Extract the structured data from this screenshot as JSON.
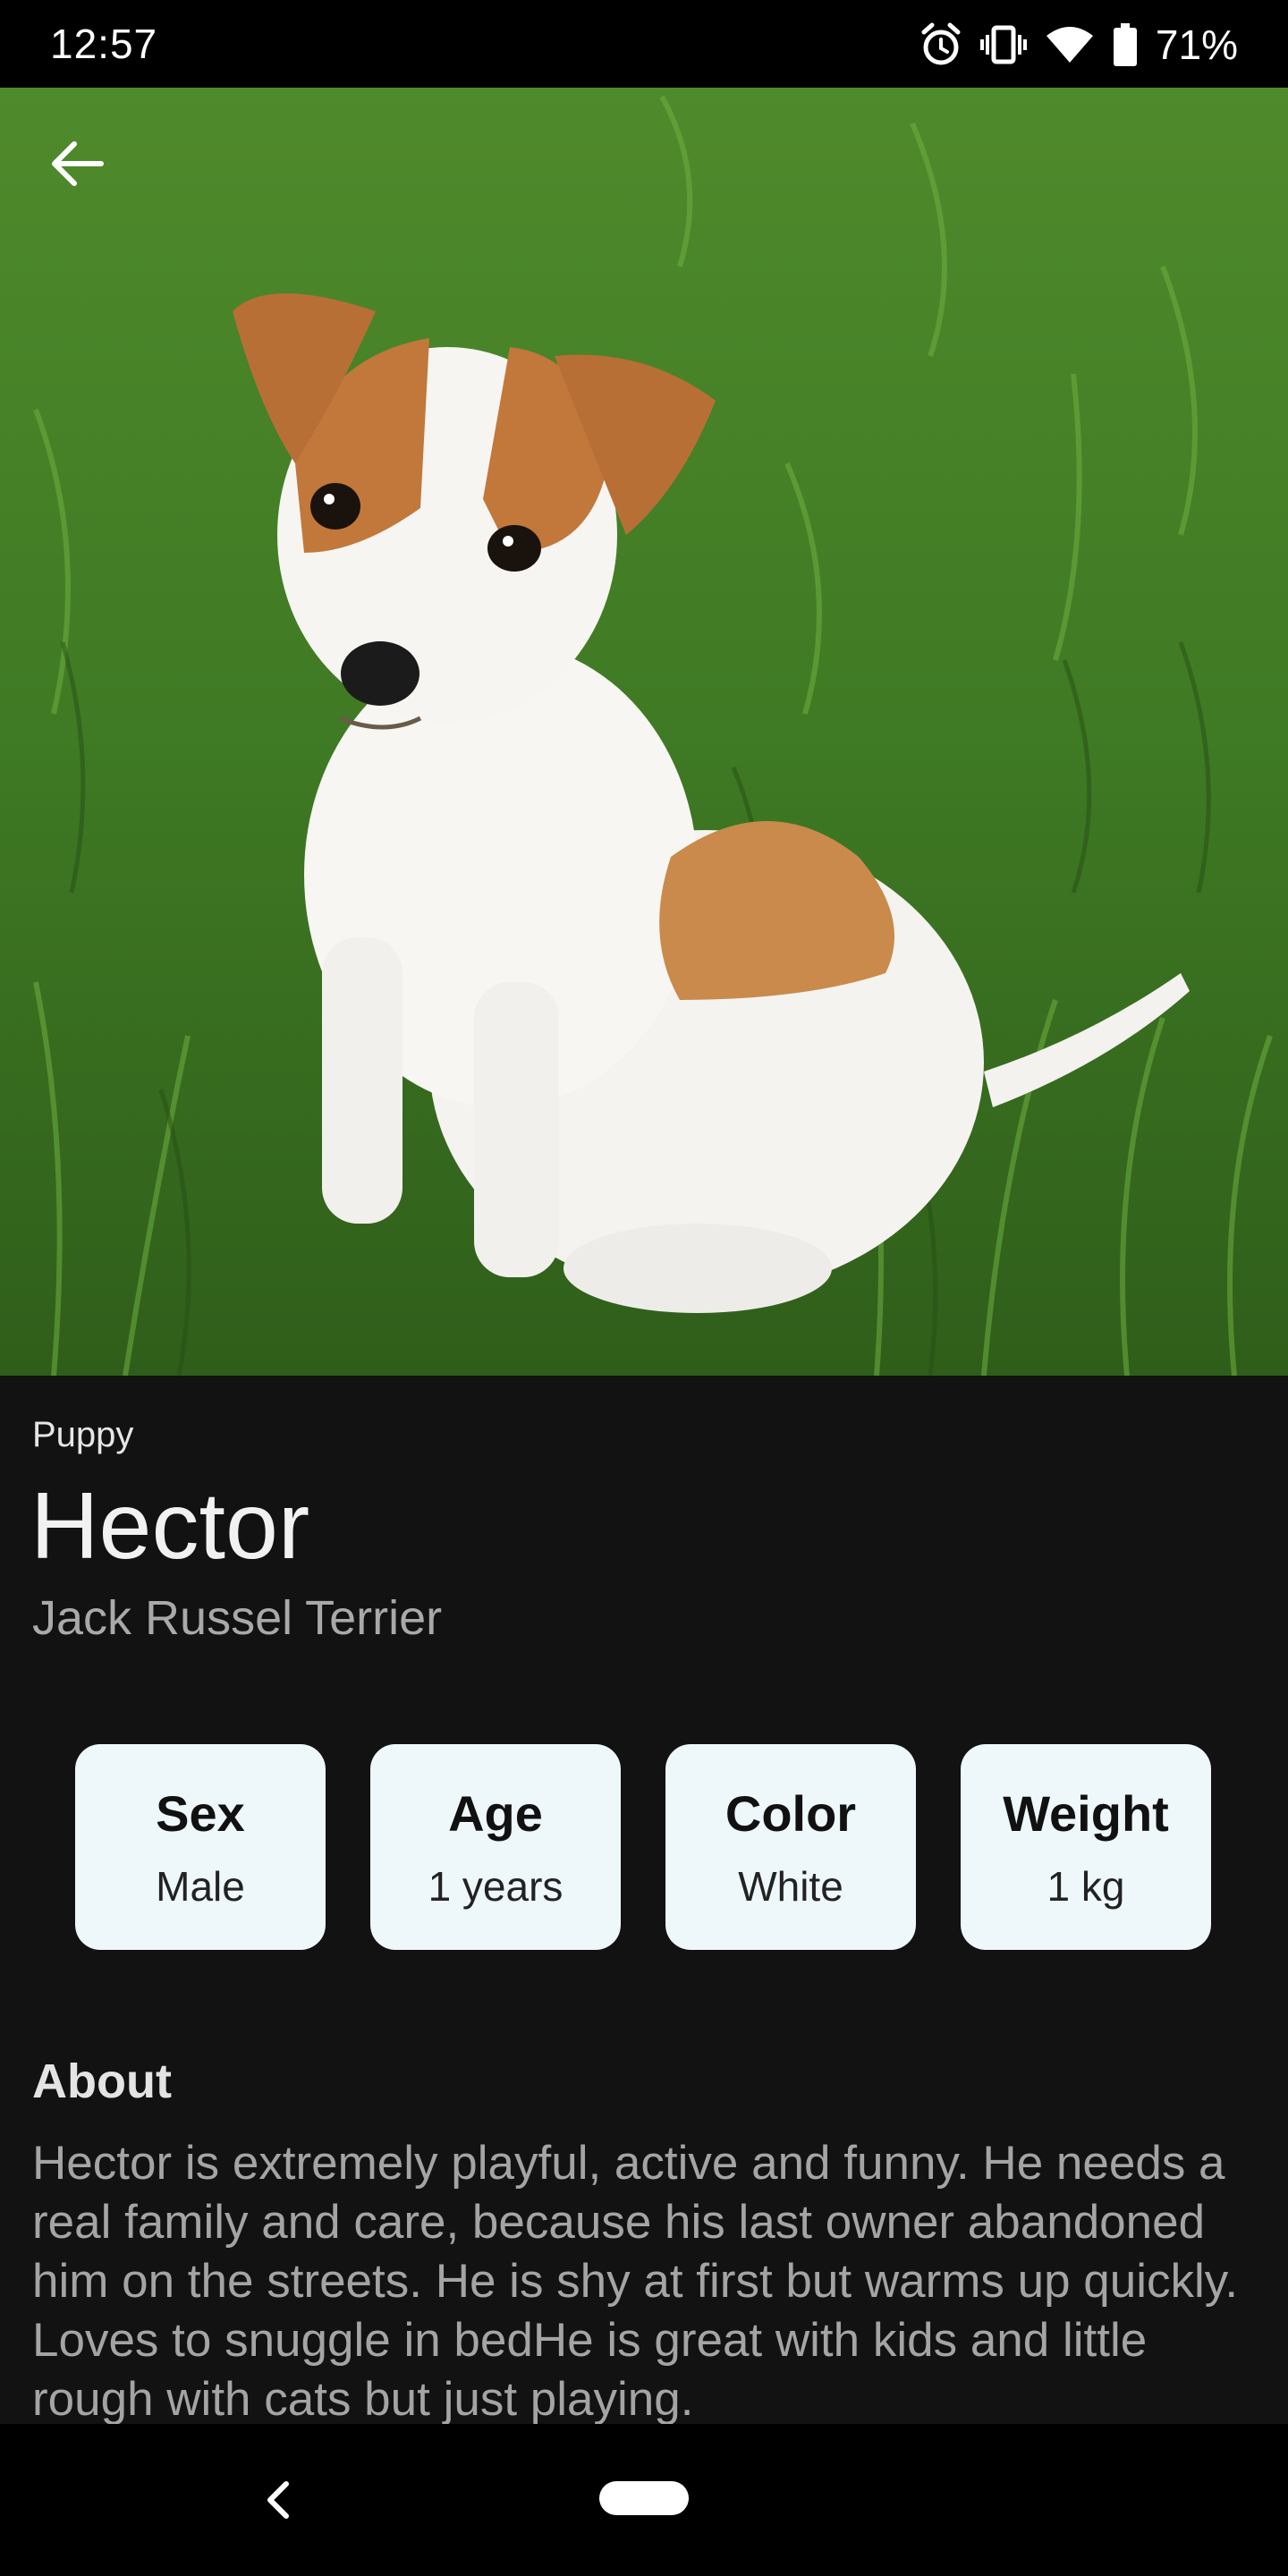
{
  "status_bar": {
    "time": "12:57",
    "battery": "71%",
    "icons": [
      "alarm-icon",
      "vibrate-icon",
      "wifi-icon",
      "battery-icon"
    ]
  },
  "header": {
    "back_icon": "arrow-left-icon"
  },
  "pet": {
    "category": "Puppy",
    "name": "Hector",
    "breed": "Jack Russel Terrier",
    "stats": [
      {
        "label": "Sex",
        "value": "Male"
      },
      {
        "label": "Age",
        "value": "1 years"
      },
      {
        "label": "Color",
        "value": "White"
      },
      {
        "label": "Weight",
        "value": "1 kg"
      }
    ],
    "about_title": "About",
    "about_text": "Hector is extremely playful, active and funny. He needs a real family and care, because his last owner abandoned him on the streets. He is shy at first but warms up quickly. Loves to snuggle in bedHe is great with kids and little rough with cats but just playing."
  },
  "nav_bar": {
    "back_icon": "chevron-left-icon",
    "home_icon": "home-pill-icon"
  },
  "colors": {
    "background": "#121212",
    "card_background": "#eef8fb",
    "status_bar": "#000000"
  }
}
